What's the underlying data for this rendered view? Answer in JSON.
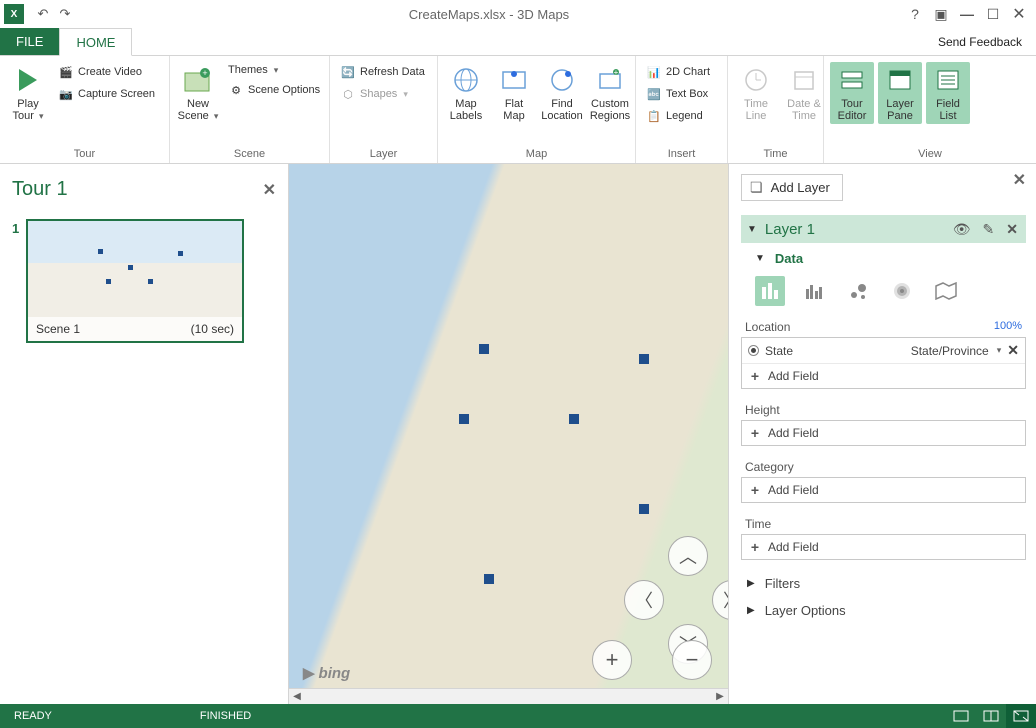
{
  "titlebar": {
    "title": "CreateMaps.xlsx - 3D Maps"
  },
  "tabs": {
    "file": "FILE",
    "home": "HOME",
    "feedback": "Send Feedback"
  },
  "ribbon": {
    "tour": {
      "play": "Play\nTour",
      "create_video": "Create Video",
      "capture_screen": "Capture Screen",
      "group": "Tour"
    },
    "scene": {
      "new_scene": "New\nScene",
      "themes": "Themes",
      "scene_options": "Scene Options",
      "group": "Scene"
    },
    "layer": {
      "refresh": "Refresh Data",
      "shapes": "Shapes",
      "group": "Layer"
    },
    "map": {
      "map_labels": "Map\nLabels",
      "flat_map": "Flat\nMap",
      "find_location": "Find\nLocation",
      "custom_regions": "Custom\nRegions",
      "group": "Map"
    },
    "insert": {
      "chart": "2D Chart",
      "textbox": "Text Box",
      "legend": "Legend",
      "group": "Insert"
    },
    "time": {
      "timeline": "Time\nLine",
      "datetime": "Date &\nTime",
      "group": "Time"
    },
    "view": {
      "tour_editor": "Tour\nEditor",
      "layer_pane": "Layer\nPane",
      "field_list": "Field\nList",
      "group": "View"
    }
  },
  "tour_panel": {
    "title": "Tour 1",
    "scene_index": "1",
    "scene_name": "Scene 1",
    "scene_duration": "(10 sec)"
  },
  "map": {
    "attribution": "bing"
  },
  "layer_pane": {
    "add_layer": "Add Layer",
    "layer_name": "Layer 1",
    "data_label": "Data",
    "location": {
      "label": "Location",
      "confidence": "100%",
      "field": "State",
      "type": "State/Province",
      "add": "Add Field"
    },
    "height": {
      "label": "Height",
      "add": "Add Field"
    },
    "category": {
      "label": "Category",
      "add": "Add Field"
    },
    "time": {
      "label": "Time",
      "add": "Add Field"
    },
    "filters": "Filters",
    "layer_options": "Layer Options"
  },
  "status": {
    "ready": "READY",
    "finished": "FINISHED"
  }
}
